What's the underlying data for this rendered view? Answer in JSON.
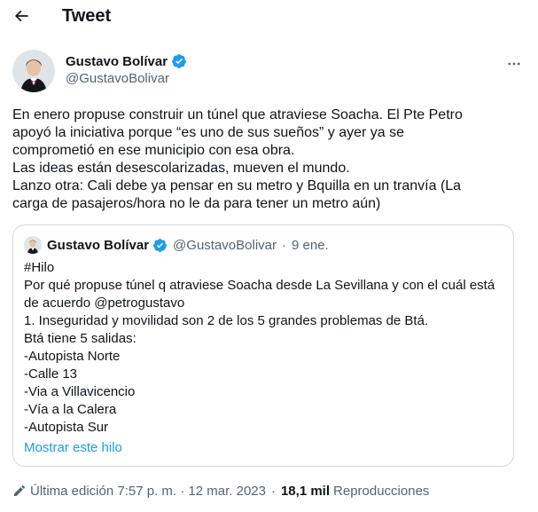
{
  "header": {
    "title": "Tweet",
    "back_icon": "arrow-left-icon"
  },
  "author": {
    "name": "Gustavo Bolívar",
    "handle": "@GustavoBolivar",
    "verified_color": "#1d9bf0",
    "avatar_icon": "profile-photo"
  },
  "tweet": {
    "lines": [
      "En enero propuse construir un túnel que atraviese Soacha. El Pte Petro",
      "apoyó la iniciativa porque “es uno de sus sueños” y ayer ya se",
      "comprometió en ese municipio con esa obra.",
      "Las ideas están desescolarizadas, mueven el mundo.",
      "Lanzo otra: Cali debe ya pensar en su metro y Bquilla en un tranvía (La",
      "carga de pasajeros/hora no le da para tener un metro aún)"
    ]
  },
  "quote": {
    "name": "Gustavo Bolívar",
    "handle": "@GustavoBolivar",
    "dot": "·",
    "date": "9 ene.",
    "lines": [
      "#Hilo",
      "Por qué propuse túnel q atraviese Soacha desde La Sevillana y con el cuál está",
      "de acuerdo @petrogustavo",
      "1. Inseguridad y movilidad son 2 de los 5 grandes problemas de Btá.",
      "Btá tiene 5 salidas:",
      "-Autopista Norte",
      "-Calle 13",
      "-Via a Villavicencio",
      "-Vía a la Calera",
      "-Autopista Sur"
    ],
    "show_thread": "Mostrar este hilo"
  },
  "footer": {
    "edited": "Última edición 7:57 p. m. · 12 mar. 2023",
    "dot": "·",
    "views_count": "18,1 mil",
    "views_label": "Reproducciones"
  },
  "colors": {
    "accent": "#1d9bf0",
    "secondary_text": "#536471",
    "border": "#cfd9de"
  }
}
